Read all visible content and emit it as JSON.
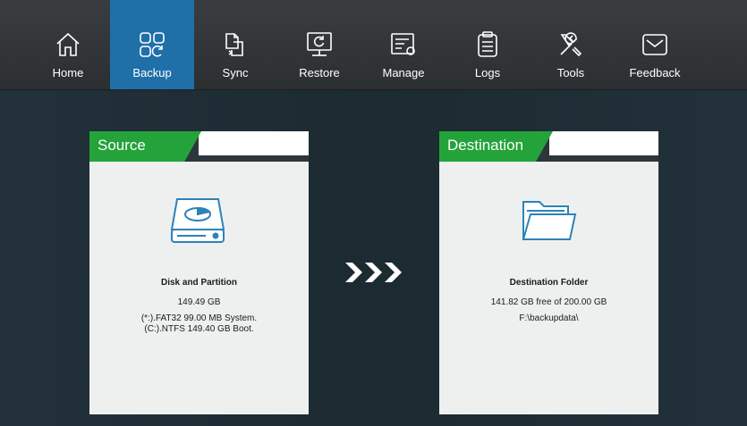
{
  "nav": {
    "items": [
      {
        "label": "Home",
        "icon": "home-icon"
      },
      {
        "label": "Backup",
        "icon": "backup-icon",
        "active": true
      },
      {
        "label": "Sync",
        "icon": "sync-icon"
      },
      {
        "label": "Restore",
        "icon": "restore-icon"
      },
      {
        "label": "Manage",
        "icon": "manage-icon"
      },
      {
        "label": "Logs",
        "icon": "logs-icon"
      },
      {
        "label": "Tools",
        "icon": "tools-icon"
      },
      {
        "label": "Feedback",
        "icon": "feedback-icon"
      }
    ]
  },
  "source": {
    "header": "Source",
    "icon": "disk-icon",
    "title": "Disk and Partition",
    "size": "149.49 GB",
    "detail_line1": "(*:).FAT32 99.00 MB System.",
    "detail_line2": "(C:).NTFS 149.40 GB Boot."
  },
  "destination": {
    "header": "Destination",
    "icon": "folder-icon",
    "title": "Destination Folder",
    "free": "141.82 GB free of 200.00 GB",
    "path": "F:\\backupdata\\"
  },
  "colors": {
    "accent_blue": "#1f6fa8",
    "header_green": "#24a33b",
    "icon_blue": "#2b83b8"
  }
}
